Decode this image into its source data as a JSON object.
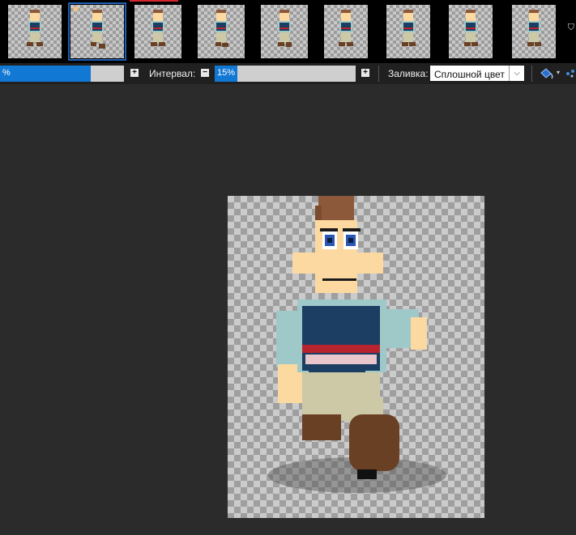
{
  "thumbnails": {
    "count": 9,
    "selected_index": 1
  },
  "toolbar": {
    "first_slider_value": "%",
    "interval_label": "Интервал:",
    "interval_value": "15%",
    "interval_percent": 15,
    "minus_label": "−",
    "plus_label": "+",
    "fill_label": "Заливка:",
    "fill_value": "Сплошной цвет",
    "dropdown_arrow": "⌵",
    "small_arrow": "▾"
  },
  "colors": {
    "accent": "#1178d4",
    "background": "#2b2b2b",
    "toolbar": "#202020",
    "skin": "#fbd9a0",
    "hair": "#8c5a3a",
    "shirt_sleeve": "#9fc9c8",
    "shirt_navy": "#1b3e62",
    "stripe_red": "#b8242e",
    "stripe_pink": "#e9c6cc",
    "pants": "#cdc9a6",
    "shoes": "#6a4024"
  },
  "icons": {
    "strip_more": "chevron-down-icon",
    "fill_tool": "paint-bucket-icon",
    "sparkle": "sparkle-icon"
  }
}
